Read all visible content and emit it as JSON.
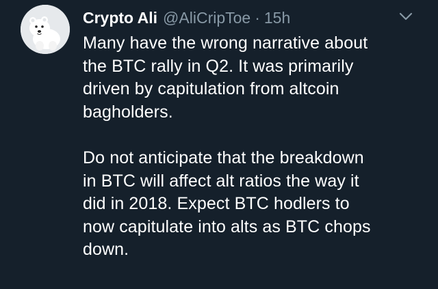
{
  "tweet": {
    "author": {
      "display_name": "Crypto Ali",
      "handle": "@AliCripToe",
      "avatar_icon": "polar-bear-avatar-icon"
    },
    "separator": "·",
    "timestamp": "15h",
    "menu_icon": "chevron-down-icon",
    "paragraphs": [
      "Many have the wrong narrative about\nthe BTC rally in Q2. It was primarily\ndriven by capitulation from altcoin\nbagholders.",
      "Do not anticipate that the breakdown\nin BTC will affect alt ratios the way it\ndid in 2018. Expect BTC hodlers to\nnow capitulate into alts as BTC chops\ndown."
    ]
  },
  "colors": {
    "background": "#15202b",
    "primary_text": "#ffffff",
    "secondary_text": "#8899a6"
  }
}
